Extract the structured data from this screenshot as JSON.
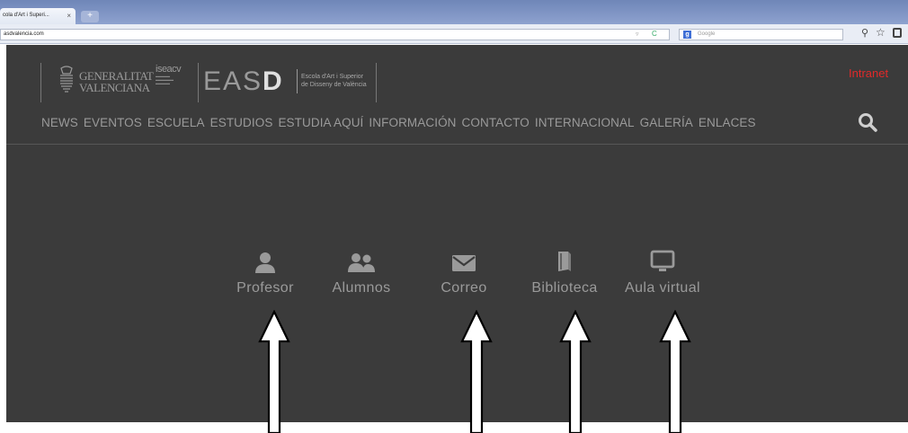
{
  "browser": {
    "tab_title": "cola d'Art i Superi...",
    "tab_close": "×",
    "new_tab": "+",
    "url": "asdvalencia.com",
    "search_placeholder": "Google",
    "icons": [
      "close-icon",
      "reload-icon",
      "search-icon",
      "star-icon"
    ]
  },
  "site": {
    "gva_line1": "GENERALITAT",
    "gva_line2": "VALENCIANA",
    "iseacv_name": "iseacv",
    "easd_prefix": "EAS",
    "easd_suffix": "D",
    "easd_sub_line1": "Escola d'Art i Superior",
    "easd_sub_line2": "de Disseny de València",
    "intranet_label": "Intranet",
    "accent_color": "#e02a2a",
    "background_color": "#3b3b3b",
    "nav": [
      "NEWS",
      "EVENTOS",
      "ESCUELA",
      "ESTUDIOS",
      "ESTUDIA AQUÍ",
      "INFORMACIÓN",
      "CONTACTO",
      "INTERNACIONAL",
      "GALERÍA",
      "ENLACES"
    ],
    "portals": [
      {
        "label": "Profesor",
        "icon": "user-icon"
      },
      {
        "label": "Alumnos",
        "icon": "users-icon"
      },
      {
        "label": "Correo",
        "icon": "envelope-icon"
      },
      {
        "label": "Biblioteca",
        "icon": "book-icon"
      },
      {
        "label": "Aula virtual",
        "icon": "monitor-icon"
      }
    ]
  }
}
